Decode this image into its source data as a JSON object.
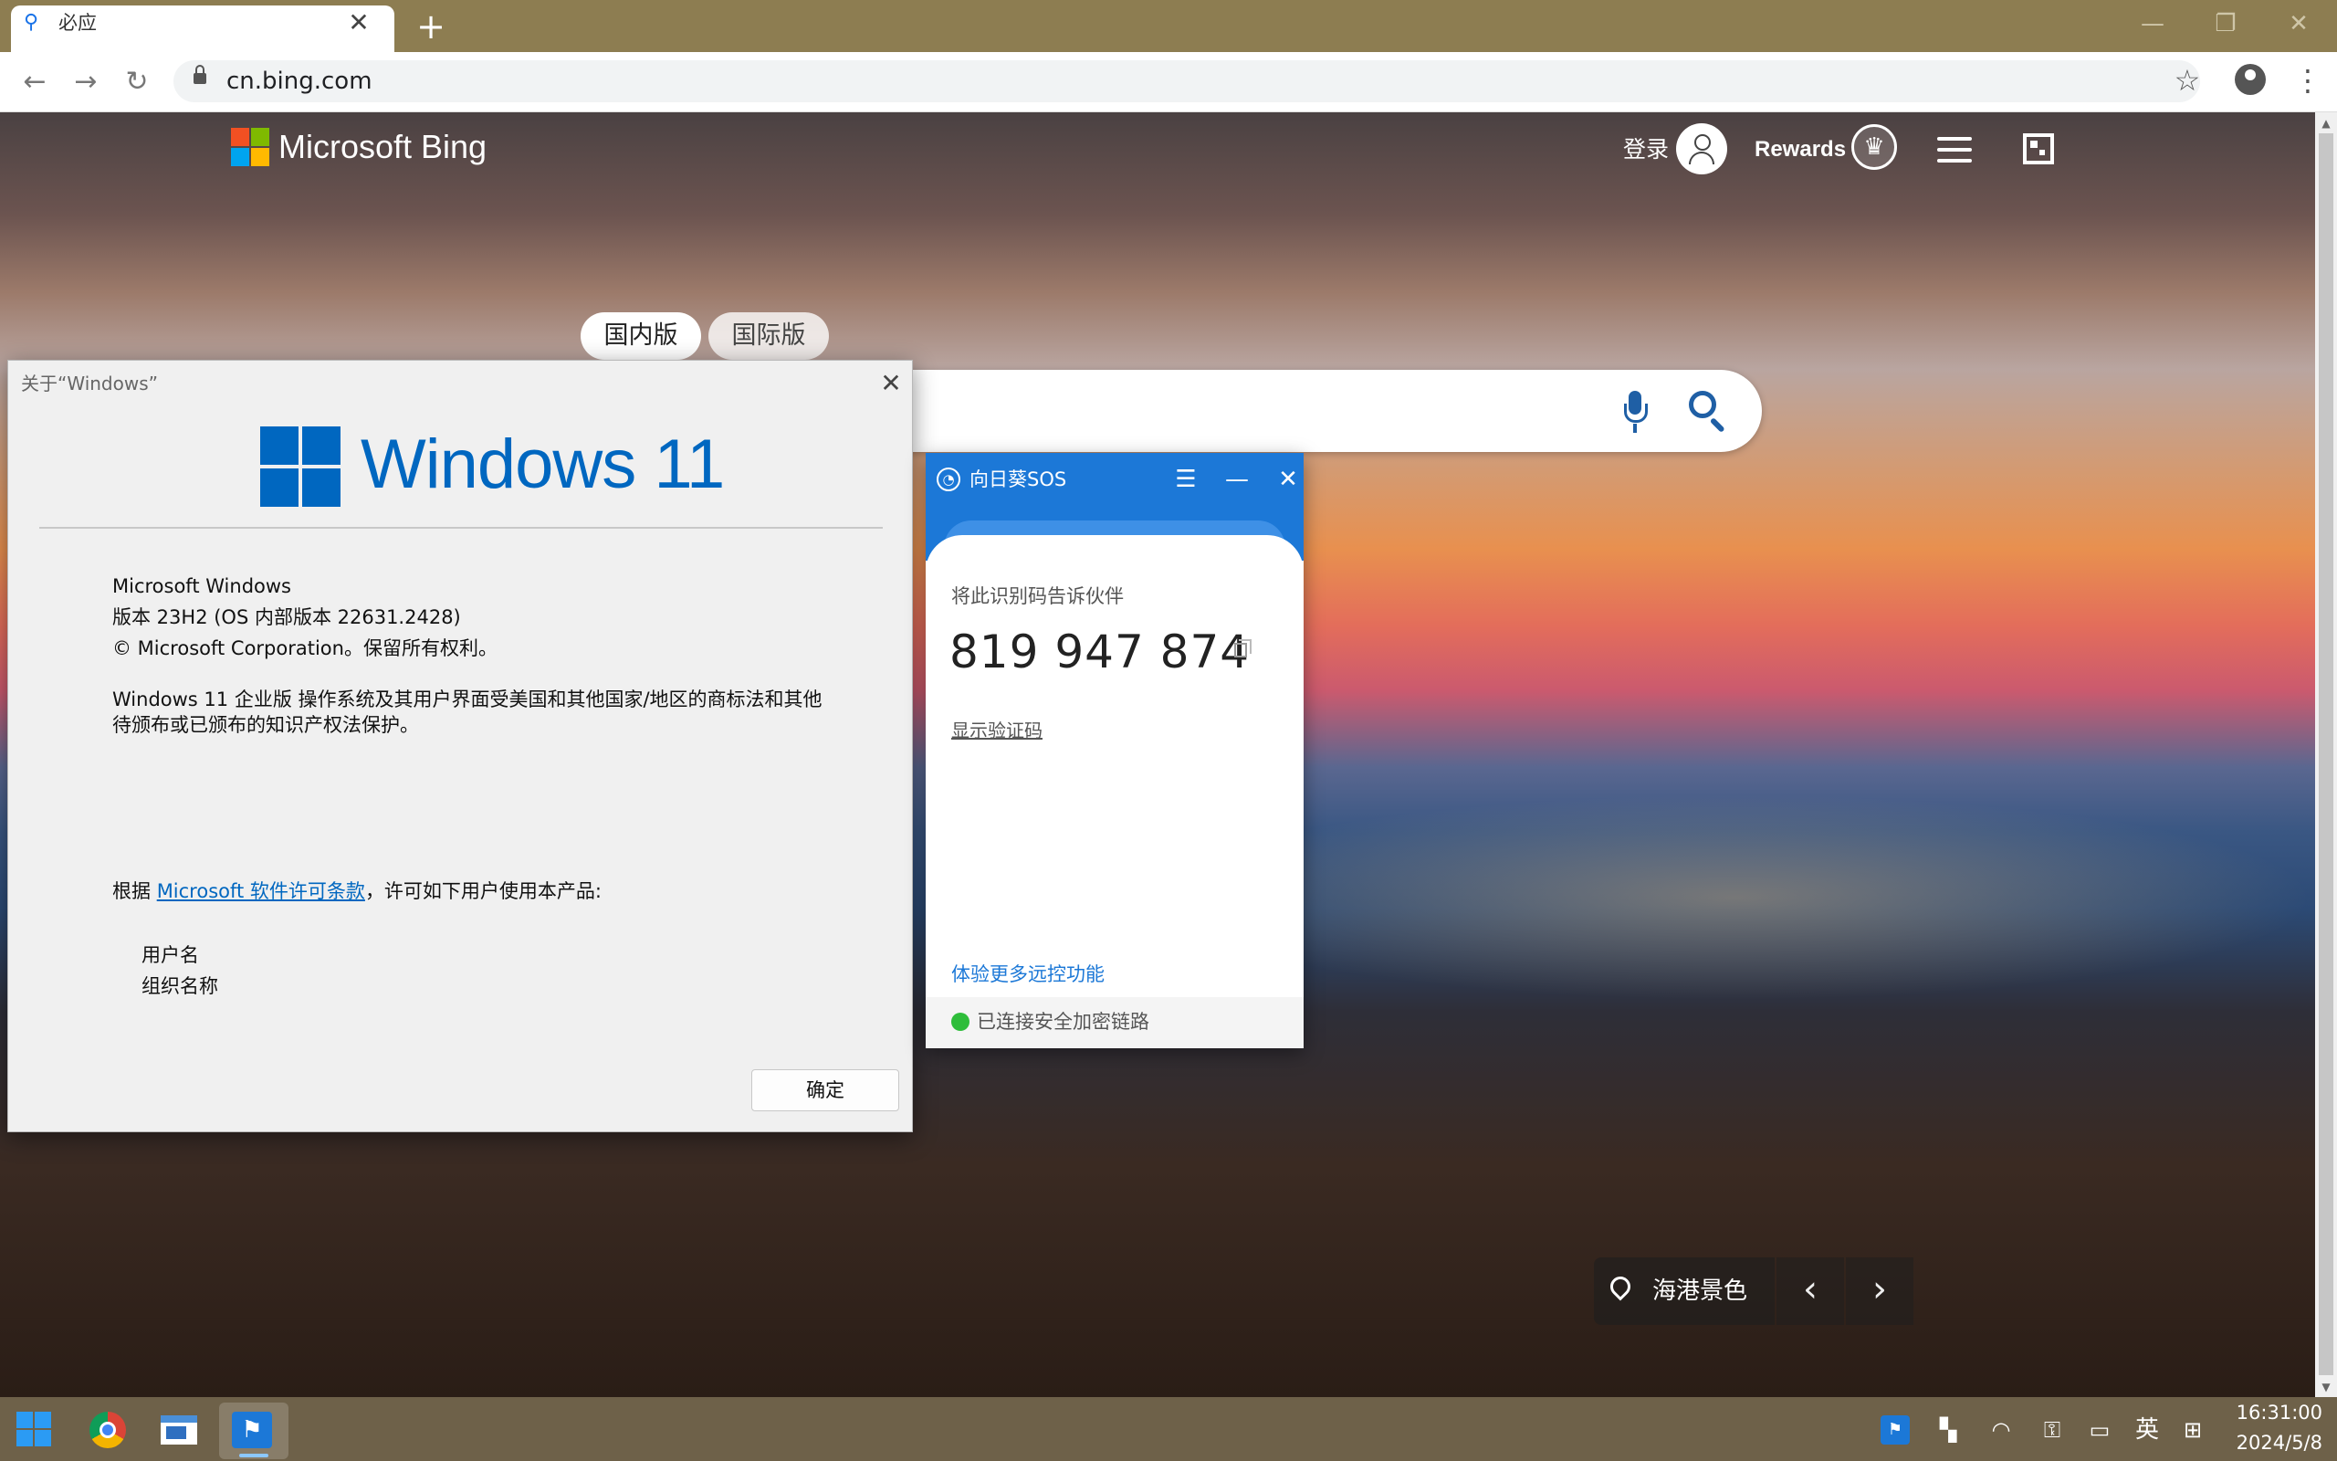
{
  "browser": {
    "tab_title": "必应",
    "new_tab": "+",
    "tab_close": "✕",
    "url": "cn.bing.com"
  },
  "bing": {
    "brand": "Microsoft Bing",
    "login": "登录",
    "rewards": "Rewards",
    "region_tabs": [
      "国内版",
      "国际版"
    ],
    "image_caption": "海港景色"
  },
  "about_windows": {
    "title": "关于“Windows”",
    "product_logo_text": "Windows 11",
    "lines": [
      "Microsoft Windows",
      "版本 23H2 (OS 内部版本 22631.2428)",
      "© Microsoft Corporation。保留所有权利。"
    ],
    "trademark_line1": "Windows 11 企业版 操作系统及其用户界面受美国和其他国家/地区的商标法和其他",
    "trademark_line2": "待颁布或已颁布的知识产权法保护。",
    "license_prefix": "根据 ",
    "license_link": "Microsoft 软件许可条款",
    "license_suffix": "，许可如下用户使用本产品:",
    "user_name": "用户名",
    "org_name": "组织名称",
    "ok_label": "确定"
  },
  "sunlogin_sos": {
    "title": "向日葵SOS",
    "prompt": "将此识别码告诉伙伴",
    "code": "819 947 874",
    "show_verify": "显示验证码",
    "more_features": "体验更多远控功能",
    "status": "已连接安全加密链路"
  },
  "taskbar": {
    "ime_lang": "英",
    "time": "16:31:00",
    "date": "2024/5/8"
  },
  "colors": {
    "windows_blue": "#0067c0",
    "sunlogin_blue": "#1c78d7",
    "status_green": "#2ebd3a",
    "bing_icon_blue": "#1f5fa5"
  }
}
